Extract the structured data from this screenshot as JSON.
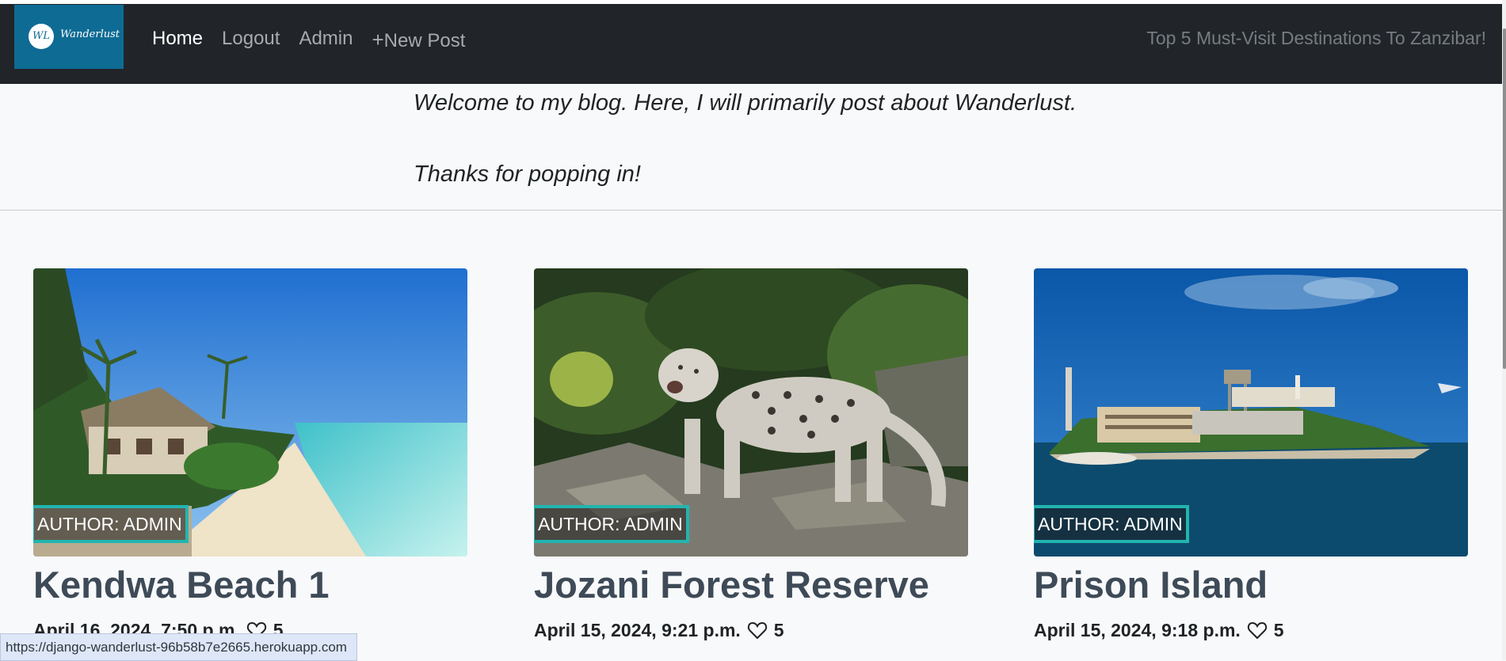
{
  "brand": {
    "logo_initials": "WL",
    "logo_text": "Wanderlust"
  },
  "nav": {
    "links": [
      {
        "label": "Home"
      },
      {
        "label": "Logout"
      },
      {
        "label": "Admin"
      },
      {
        "label": "New Post",
        "icon": "plus-icon"
      }
    ],
    "right_text": "Top 5 Must-Visit Destinations To Zanzibar!"
  },
  "intro": {
    "line1": "Welcome to my blog. Here, I will primarily post about Wanderlust.",
    "line2": "Thanks for popping in!"
  },
  "posts": [
    {
      "author": "AUTHOR: ADMIN",
      "title": "Kendwa Beach 1",
      "date": "April 16, 2024, 7:50 p.m.",
      "likes": "5"
    },
    {
      "author": "AUTHOR: ADMIN",
      "title": "Jozani Forest Reserve",
      "date": "April 15, 2024, 9:21 p.m.",
      "likes": "5"
    },
    {
      "author": "AUTHOR: ADMIN",
      "title": "Prison Island",
      "date": "April 15, 2024, 9:18 p.m.",
      "likes": "5"
    }
  ],
  "status_url": "https://django-wanderlust-96b58b7e2665.herokuapp.com",
  "colors": {
    "navbar": "#212529",
    "brand": "#0e6b94",
    "badge_border": "#22b5b0",
    "title": "#3e4a57"
  }
}
